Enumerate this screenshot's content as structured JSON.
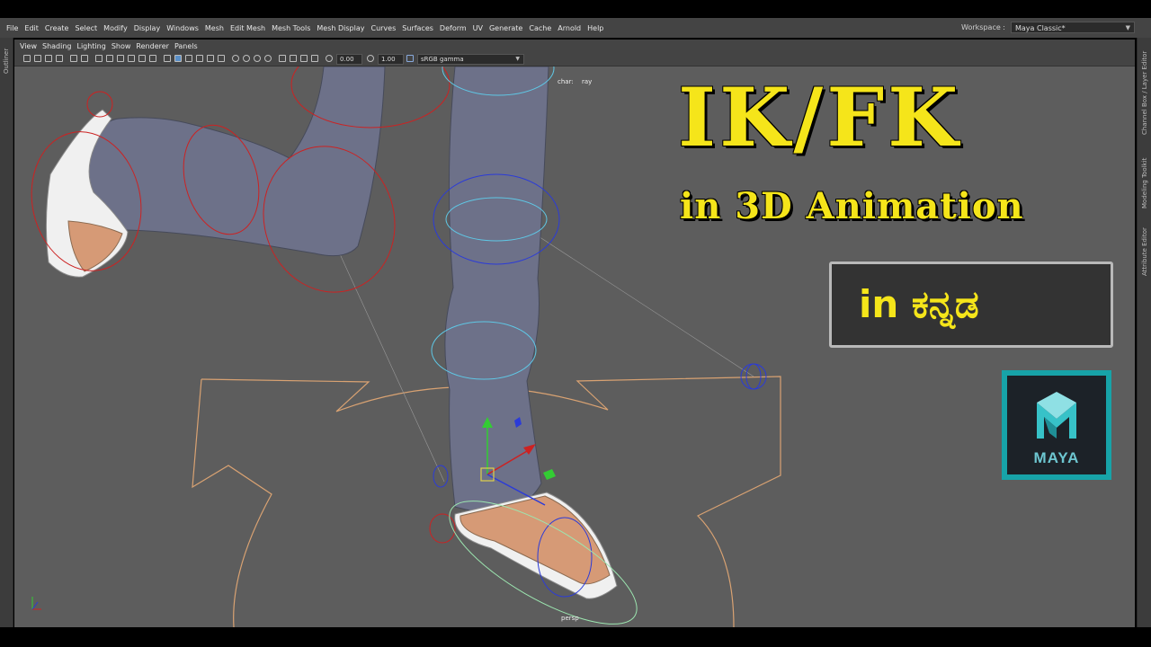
{
  "menubar": {
    "items": [
      "File",
      "Edit",
      "Create",
      "Select",
      "Modify",
      "Display",
      "Windows",
      "Mesh",
      "Edit Mesh",
      "Mesh Tools",
      "Mesh Display",
      "Curves",
      "Surfaces",
      "Deform",
      "UV",
      "Generate",
      "Cache",
      "Arnold",
      "Help"
    ],
    "workspace_label": "Workspace :",
    "workspace_value": "Maya Classic*"
  },
  "panel_menu": {
    "items": [
      "View",
      "Shading",
      "Lighting",
      "Show",
      "Renderer",
      "Panels"
    ]
  },
  "toolbar": {
    "exposure": "0.00",
    "gamma": "1.00",
    "color_space": "sRGB gamma"
  },
  "side_tabs": {
    "left": "Outliner",
    "right_top": "Channel Box / Layer Editor",
    "right_mid": "Modeling Toolkit",
    "right_bottom": "Attribute Editor"
  },
  "viewport": {
    "hud_char_label": "char:",
    "hud_char_value": "ray",
    "camera_name": "persp"
  },
  "thumbnail": {
    "title": "IK/FK",
    "subtitle": "in 3D Animation",
    "kannada_text": "in ಕನ್ನಡ",
    "logo_text": "MAYA"
  },
  "colors": {
    "title_yellow": "#f5e51a",
    "maya_teal": "#17a3a8",
    "viewport_bg": "#5d5d5d",
    "ui_bg": "#444444"
  }
}
